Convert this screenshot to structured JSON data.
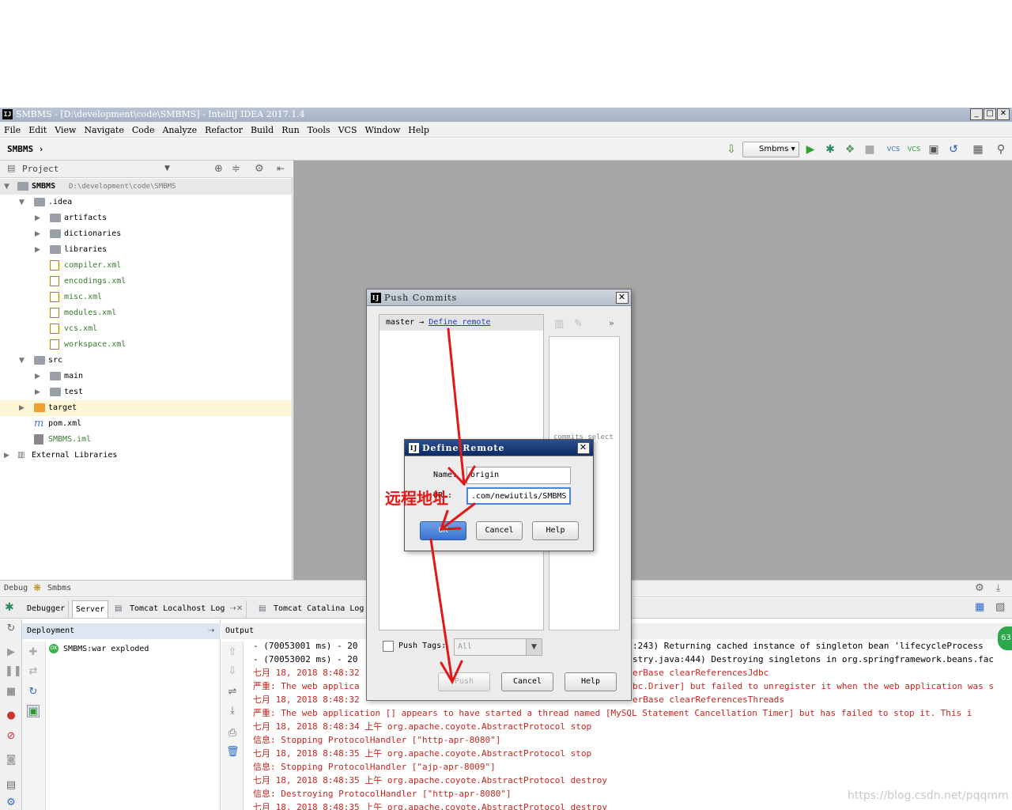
{
  "window": {
    "logo_text": "IJ",
    "title": "SMBMS - [D:\\development\\code\\SMBMS] - IntelliJ IDEA 2017.1.4",
    "minimize": "_",
    "maximize": "□",
    "close": "✕"
  },
  "menu": [
    "File",
    "Edit",
    "View",
    "Navigate",
    "Code",
    "Analyze",
    "Refactor",
    "Build",
    "Run",
    "Tools",
    "VCS",
    "Window",
    "Help"
  ],
  "navbar": {
    "breadcrumb": "SMBMS",
    "run_config": "Smbms",
    "vcs1": "VCS",
    "vcs2": "VCS"
  },
  "project_panel": {
    "header_label": "Project",
    "root_name": "SMBMS",
    "root_path": "D:\\development\\code\\SMBMS",
    "items": [
      {
        "label": ".idea"
      },
      {
        "label": "artifacts"
      },
      {
        "label": "dictionaries"
      },
      {
        "label": "libraries"
      },
      {
        "label": "compiler.xml"
      },
      {
        "label": "encodings.xml"
      },
      {
        "label": "misc.xml"
      },
      {
        "label": "modules.xml"
      },
      {
        "label": "vcs.xml"
      },
      {
        "label": "workspace.xml"
      },
      {
        "label": "src"
      },
      {
        "label": "main"
      },
      {
        "label": "test"
      },
      {
        "label": "target"
      },
      {
        "label": "pom.xml"
      },
      {
        "label": "SMBMS.iml"
      },
      {
        "label": "External Libraries"
      }
    ]
  },
  "debug": {
    "header_label": "Debug",
    "config_name": "Smbms",
    "tabs": [
      "Debugger",
      "Server",
      "Tomcat Localhost Log",
      "Tomcat Catalina Log"
    ],
    "deployment_header": "Deployment",
    "deployment_item": "SMBMS:war exploded",
    "output_header": "Output",
    "log_lines": [
      "- (70053001 ms) - 20",
      "- (70053002 ms) - 20",
      "七月 18, 2018 8:48:32",
      "严重: The web applica",
      "七月 18, 2018 8:48:32",
      "严重: The web application [] appears to have started a thread named [MySQL Statement Cancellation Timer] but has failed to stop it. This i",
      "七月 18, 2018 8:48:34 上午 org.apache.coyote.AbstractProtocol stop",
      "信息: Stopping ProtocolHandler [\"http-apr-8080\"]",
      "七月 18, 2018 8:48:35 上午 org.apache.coyote.AbstractProtocol stop",
      "信息: Stopping ProtocolHandler [\"ajp-apr-8009\"]",
      "七月 18, 2018 8:48:35 上午 org.apache.coyote.AbstractProtocol destroy",
      "信息: Destroying ProtocolHandler [\"http-apr-8080\"]",
      "七月 18, 2018 8:48:35 上午 org.apache.coyote.AbstractProtocol destroy"
    ],
    "log_tails": [
      ":243) Returning cached instance of singleton bean 'lifecycleProcess",
      "stry.java:444) Destroying singletons in org.springframework.beans.fac",
      "erBase clearReferencesJdbc",
      "bc.Driver] but failed to unregister it when the web application was s",
      "erBase clearReferencesThreads"
    ]
  },
  "push_dialog": {
    "title": "Push Commits",
    "branch": "master",
    "arrow": "→",
    "define_remote": "Define remote",
    "commit_hint": "commits select",
    "push_tags_label": "Push Tags:",
    "tags_value": "All",
    "push_button": "Push",
    "cancel_button": "Cancel",
    "help_button": "Help",
    "more": "»"
  },
  "remote_dialog": {
    "title": "Define Remote",
    "name_label": "Name:",
    "name_value": "origin",
    "url_label": "URL:",
    "url_value": ".com/newiutils/SMBMS",
    "ok_button": "OK",
    "cancel_button": "Cancel",
    "help_button": "Help"
  },
  "annotation": {
    "text": "远程地址",
    "color": "#e01818"
  },
  "watermark": "https://blog.csdn.net/pqqmm",
  "badge": "63"
}
